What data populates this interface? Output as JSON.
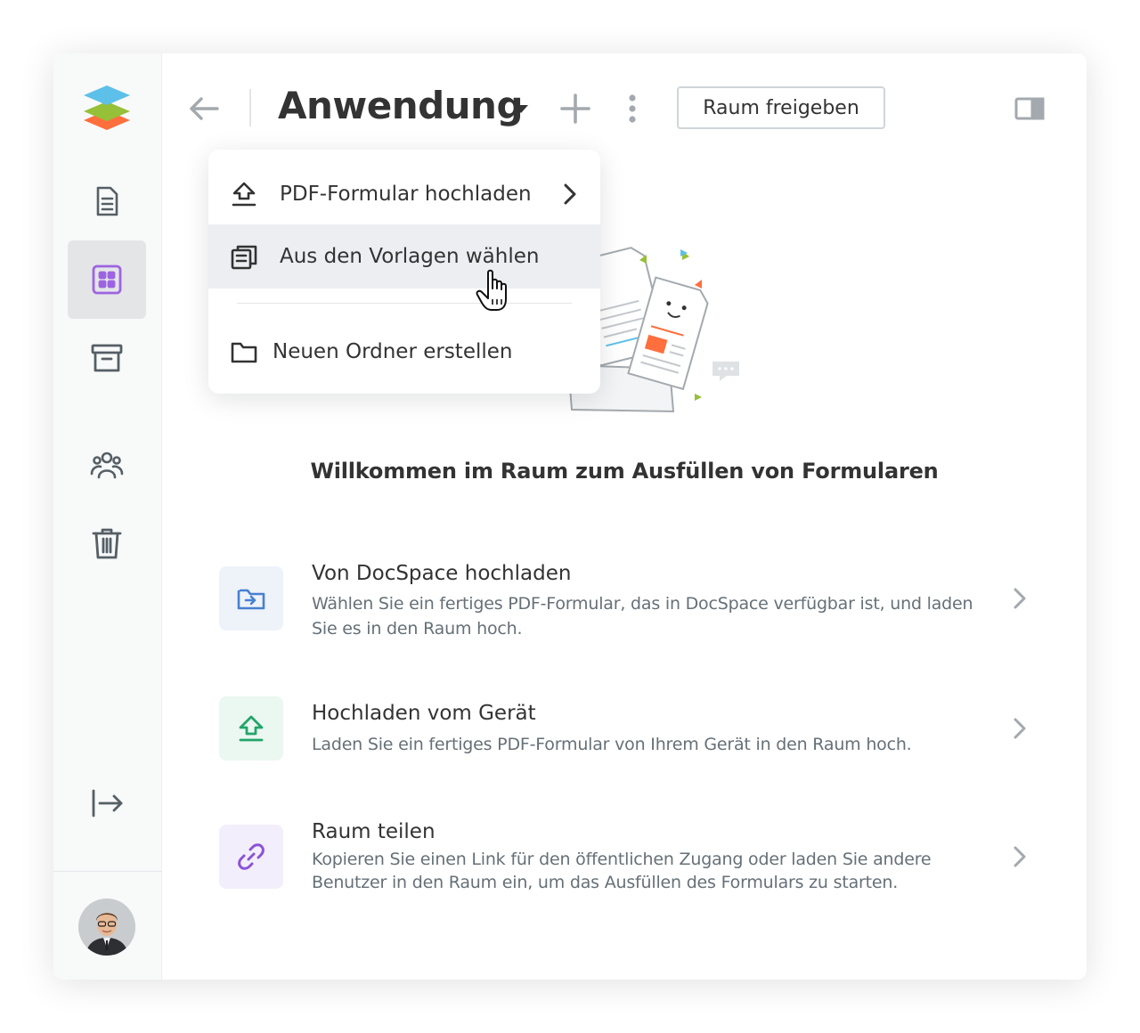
{
  "header": {
    "room_title": "Anwendung",
    "share_button": "Raum freigeben"
  },
  "sidebar": {
    "items": [
      {
        "icon": "document-icon",
        "active": false
      },
      {
        "icon": "rooms-icon",
        "active": true
      },
      {
        "icon": "archive-icon",
        "active": false
      },
      {
        "icon": "people-icon",
        "active": false
      },
      {
        "icon": "trash-icon",
        "active": false
      }
    ],
    "collapse_icon": "collapse-arrow-icon",
    "accent": "#9d64e1"
  },
  "menu": {
    "items": [
      {
        "label": "PDF-Formular hochladen",
        "icon": "upload-icon",
        "has_submenu": true
      },
      {
        "label": "Aus den Vorlagen wählen",
        "icon": "templates-icon",
        "hovered": true
      },
      {
        "label": "Neuen Ordner erstellen",
        "icon": "folder-icon"
      }
    ]
  },
  "main": {
    "welcome": "Willkommen im Raum zum Ausfüllen von Formularen",
    "options": [
      {
        "title": "Von DocSpace hochladen",
        "description": "Wählen Sie ein fertiges PDF-Formular, das in DocSpace verfügbar ist, und laden Sie es in den Raum hoch.",
        "icon": "folder-arrow-icon",
        "icon_color": "#4781d1",
        "bg_color": "#eef2f9"
      },
      {
        "title": "Hochladen vom Gerät",
        "description": "Laden Sie ein fertiges PDF-Formular von Ihrem Gerät in den Raum hoch.",
        "icon": "upload-device-icon",
        "icon_color": "#22a56a",
        "bg_color": "#ebf7f1"
      },
      {
        "title": "Raum teilen",
        "description": "Kopieren Sie einen Link für den öffentlichen Zugang oder laden Sie andere Benutzer in den Raum ein, um das Ausfüllen des Formulars zu starten.",
        "icon": "link-icon",
        "icon_color": "#8a54d8",
        "bg_color": "#f3eefb"
      }
    ]
  }
}
